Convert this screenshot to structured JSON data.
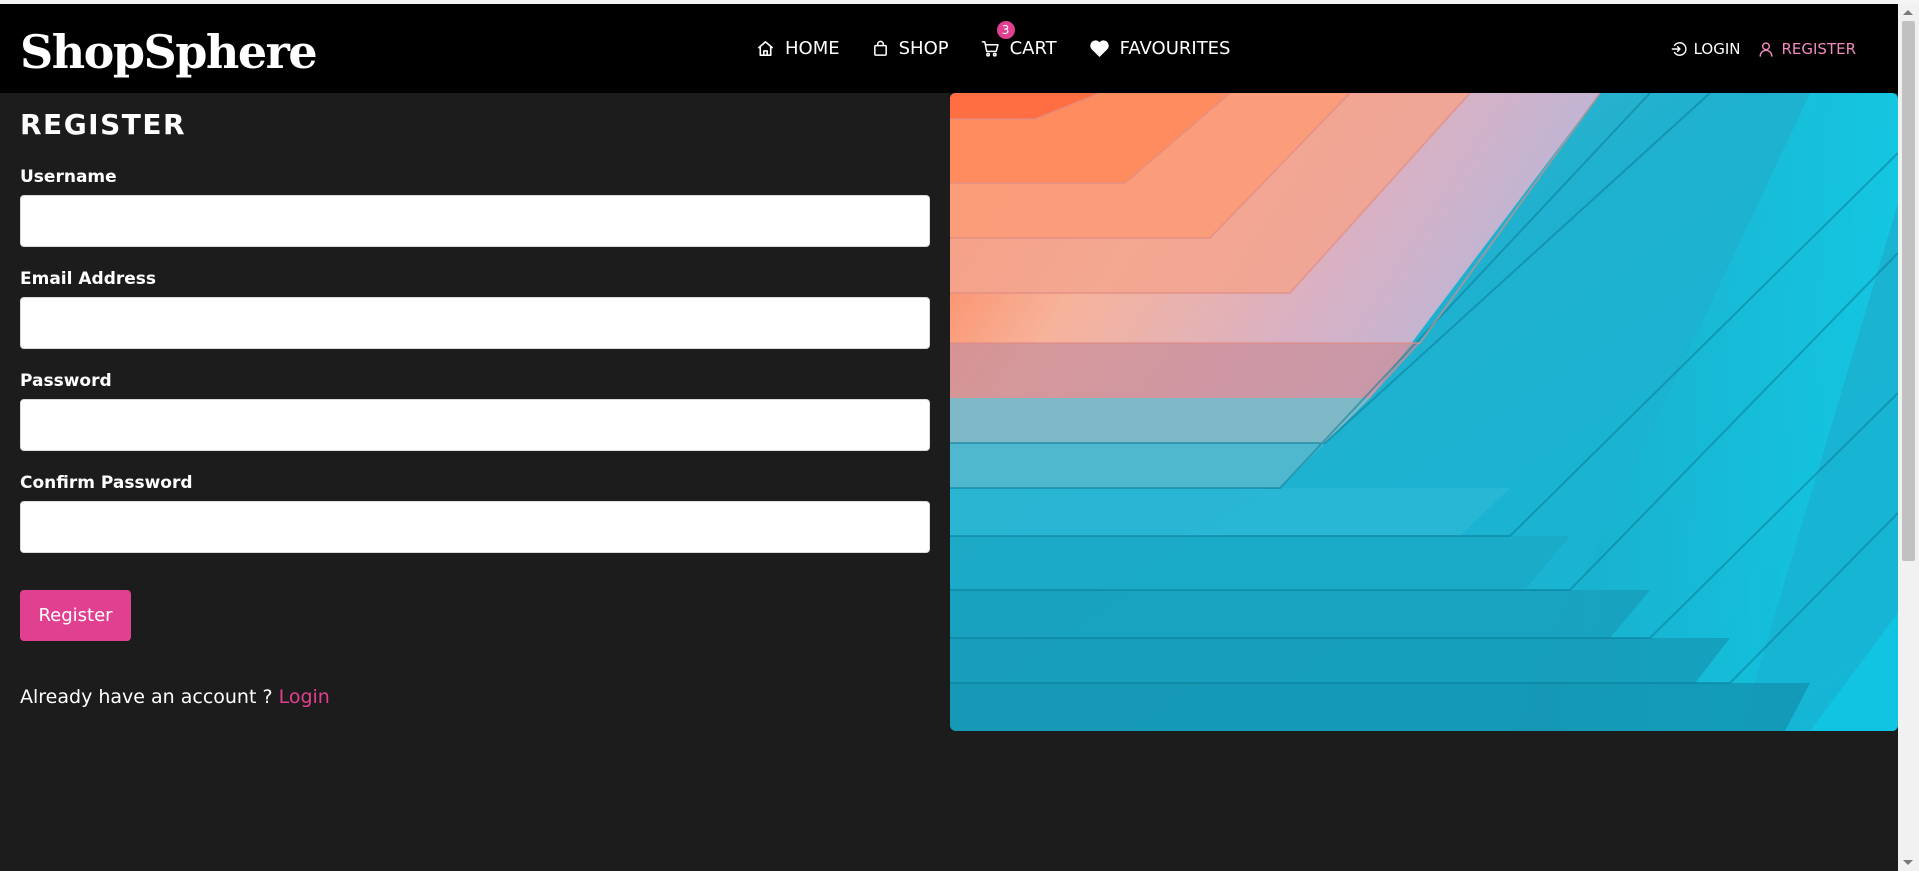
{
  "brand": {
    "name": "ShopSphere"
  },
  "nav": {
    "home": "HOME",
    "shop": "SHOP",
    "cart": "CART",
    "cart_count": "3",
    "favourites": "FAVOURITES",
    "login": "LOGIN",
    "register": "REGISTER"
  },
  "form": {
    "title": "REGISTER",
    "fields": [
      {
        "label": "Username",
        "value": ""
      },
      {
        "label": "Email Address",
        "value": ""
      },
      {
        "label": "Password",
        "value": ""
      },
      {
        "label": "Confirm Password",
        "value": ""
      }
    ],
    "submit_label": "Register",
    "account_prompt": "Already have an account ? ",
    "login_link": "Login"
  },
  "colors": {
    "accent": "#e0408f",
    "navbar_bg": "#000000",
    "page_bg": "#1c1c1c"
  },
  "icons": {
    "home": "home-icon",
    "shop": "shopping-bag-icon",
    "cart": "cart-icon",
    "favourites": "heart-icon",
    "login": "login-icon",
    "register": "user-icon"
  }
}
